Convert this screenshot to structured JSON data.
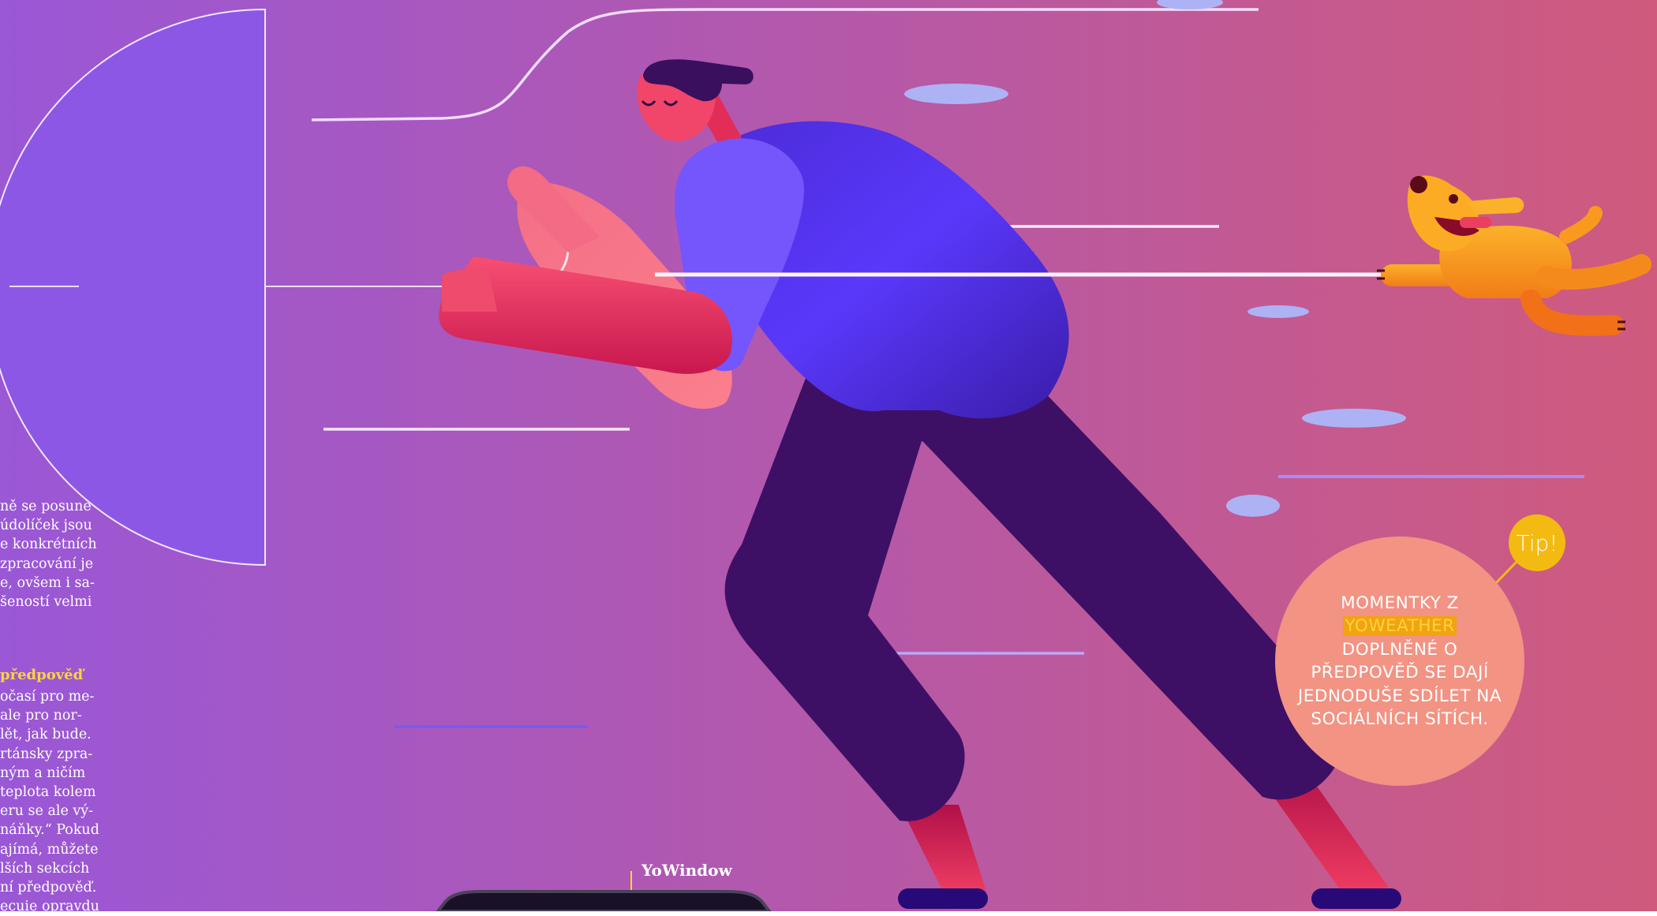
{
  "article": {
    "paragraph_upper": [
      "ně se posune",
      "údolíček jsou",
      "e konkrétních",
      "zpracování je",
      "e, ovšem i sa-",
      "šeností velmi"
    ],
    "subheading": "předpověď",
    "paragraph_lower": [
      "očasí pro me-",
      "ale pro nor-",
      "lět, jak bude.",
      "rtánsky zpra-",
      "ným a ničím",
      "teplota kolem",
      "eru se ale vý-",
      "náňky.“ Pokud",
      "ajímá, můžete",
      "lších sekcích",
      "ní předpověď.",
      "ecuie opravdu"
    ]
  },
  "tip": {
    "badge": "Tip!",
    "text_before": "MOMENTKY Z",
    "highlight": "YOWEATHER",
    "text_after": "DOPLNĚNÉ O PŘEDPOVĚĎ SE DAJÍ JEDNODUŠE SDÍLET NA SOCIÁLNÍCH SÍTÍCH."
  },
  "app_label": "YoWindow",
  "colors": {
    "background_left": "#9a57d6",
    "background_right": "#cf5a7d",
    "umbrella": "#8d57e6",
    "jacket": "#5a36f5",
    "pants": "#3d1065",
    "skin": "#f2456a",
    "dog": "#f99a1f",
    "cloud": "#adb2f5",
    "tip_bubble": "#f29383",
    "tip_badge": "#f3ba12",
    "highlight": "#ffd43a"
  }
}
